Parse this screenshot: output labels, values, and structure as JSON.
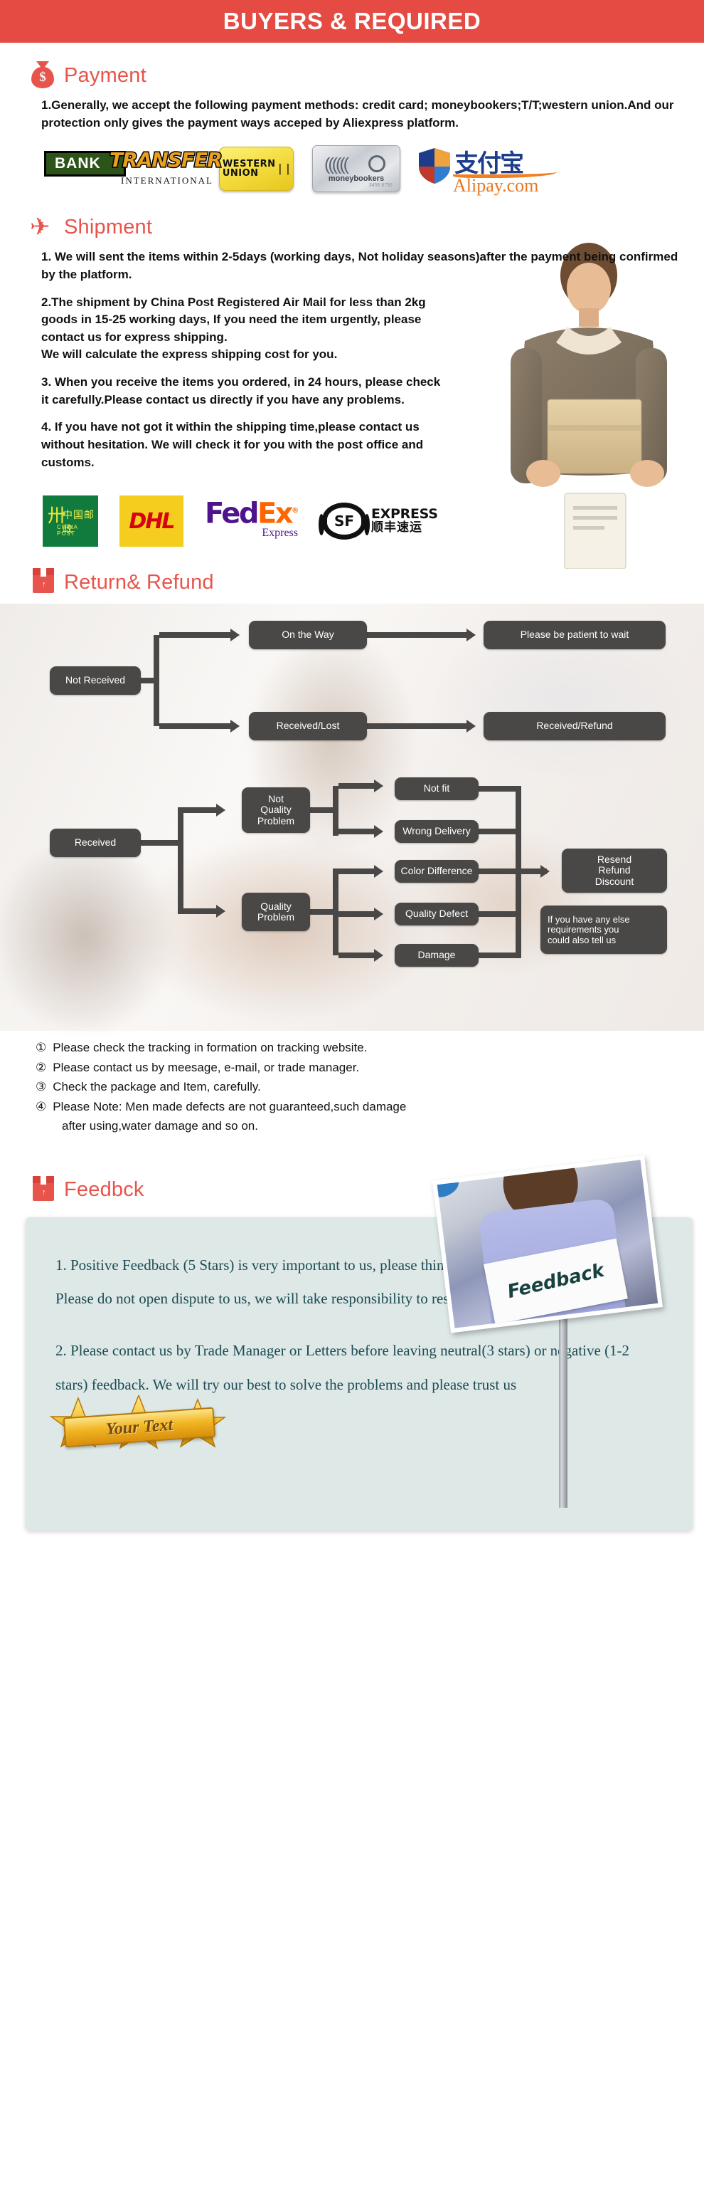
{
  "banner": {
    "title": "BUYERS & REQUIRED"
  },
  "payment": {
    "icon": "money-bag-icon",
    "heading": "Payment",
    "paragraphs": [
      "1.Generally, we accept the following payment methods: credit card; moneybookers;T/T;western union.And our protection only gives the payment ways acceped by Aliexpress platform."
    ],
    "logos": [
      {
        "name": "bank-transfer-logo",
        "primary": "BANK",
        "secondary": "TRANSFER",
        "tertiary": "INTERNATIONAL"
      },
      {
        "name": "western-union-logo",
        "line1": "WESTERN",
        "line2": "UNION"
      },
      {
        "name": "moneybookers-logo",
        "label": "moneybookers",
        "number": "3456 8792"
      },
      {
        "name": "alipay-logo",
        "cn": "支付宝",
        "label": "Alipay.com"
      }
    ]
  },
  "shipment": {
    "icon": "airplane-icon",
    "heading": "Shipment",
    "paragraphs": [
      "1. We will sent the items within 2-5days (working days, Not holiday seasons)after the payment being confirmed by the platform.",
      "2.The shipment by China Post Registered Air Mail for less than  2kg goods in 15-25 working days, If  you need the item urgently, please contact us for express shipping.\nWe will calculate the express shipping cost for you.",
      "3. When you receive the items you ordered, in 24 hours, please check it carefully.Please contact us directly if you have any problems.",
      "4. If you have not got it within the shipping time,please contact us without hesitation. We will check it for you with the post office and customs."
    ],
    "line2a": "2.The shipment by China Post Registered Air Mail for less than  2kg",
    "line2b": "goods in 15-25 working days, If  you need the item urgently, please",
    "line2c": "contact us for express shipping.",
    "line2d": "We will calculate the express shipping cost for you.",
    "line3a": "3. When you receive the items you ordered, in 24 hours, please check",
    "line3b": " it carefully.Please contact us directly if you have any problems.",
    "line4a": "4. If you have not got it within the shipping time,please contact us",
    "line4b": "without hesitation. We will check it for you with the post office and",
    "line4c": "customs.",
    "carriers": [
      {
        "name": "china-post-logo",
        "cn": "中国邮政",
        "en": "CHINA POST"
      },
      {
        "name": "dhl-logo",
        "label": "DHL"
      },
      {
        "name": "fedex-logo",
        "part1": "Fed",
        "part2": "Ex",
        "sub": "Express"
      },
      {
        "name": "sf-express-logo",
        "badge": "SF",
        "en": "EXPRESS",
        "cn": "顺丰速运"
      }
    ]
  },
  "returns": {
    "icon": "box-icon",
    "heading": "Return& Refund",
    "flow": {
      "not_received": "Not Received",
      "on_the_way": "On the Way",
      "please_wait": "Please be patient to wait",
      "received_lost": "Received/Lost",
      "received_refund": "Received/Refund",
      "received": "Received",
      "not_quality_problem": "Not\nQuality\nProblem",
      "quality_problem": "Quality\nProblem",
      "not_fit": "Not fit",
      "wrong_delivery": "Wrong Delivery",
      "color_difference": "Color Difference",
      "quality_defect": "Quality Defect",
      "damage": "Damage",
      "resend_refund_discount": "Resend\nRefund\nDiscount",
      "callout": "If you have any else\nrequirements you\ncould also tell us"
    },
    "notes": [
      {
        "num": "①",
        "text": "Please check the tracking in formation on tracking website."
      },
      {
        "num": "②",
        "text": "Please contact us by meesage, e-mail, or trade manager."
      },
      {
        "num": "③",
        "text": "Check the package and Item, carefully."
      },
      {
        "num": "④",
        "text": "Please Note: Men made defects  are not guaranteed,such damage",
        "cont": "after using,water damage and so on."
      }
    ]
  },
  "feedback": {
    "icon": "box-icon",
    "heading": "Feedbck",
    "photo_sign_text": "Feedback",
    "paragraphs": [
      "1. Positive Feedback (5 Stars) is very important to us, please think twice before leaving feedback. Please do not open dispute to us,   we will take responsibility to resend or refund for any problems.",
      "2. Please contact us by Trade Manager or Letters before leaving neutral(3 stars) or negative (1-2 stars) feedback. We will try our best to solve the problems and please trust us"
    ],
    "ribbon_text": "Your Text"
  },
  "colors": {
    "banner_red": "#e54b42",
    "heading_red": "#e8544b",
    "node_gray": "#4a4846",
    "feedback_card": "#dde8e7",
    "feedback_text": "#1d4c53"
  }
}
